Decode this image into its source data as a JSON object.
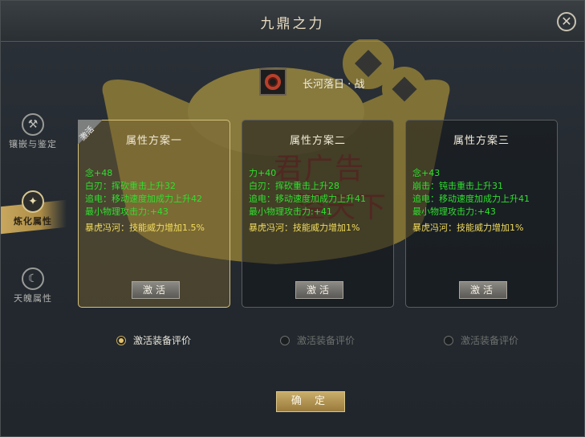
{
  "window": {
    "title": "九鼎之力"
  },
  "item": {
    "name": "长河落日 · 战"
  },
  "sidebar": {
    "items": [
      {
        "label": "镶嵌与鉴定",
        "active": false
      },
      {
        "label": "炼化属性",
        "active": true
      },
      {
        "label": "天魄属性",
        "active": false
      }
    ]
  },
  "plans": [
    {
      "title": "属性方案一",
      "badge": "激活",
      "attrs_green": [
        "念+48",
        "白刃：挥砍重击上升32",
        "追电：移动速度加成力上升42",
        "最小物理攻击力:+43"
      ],
      "attr_yellow": "暴虎冯河：技能威力增加1.5%",
      "button": "激活"
    },
    {
      "title": "属性方案二",
      "attrs_green": [
        "力+40",
        "白刃：挥砍重击上升28",
        "追电：移动速度加成力上升41",
        "最小物理攻击力:+41"
      ],
      "attr_yellow": "暴虎冯河：技能威力增加1%",
      "button": "激活"
    },
    {
      "title": "属性方案三",
      "attrs_green": [
        "念+43",
        "崩击：钝击重击上升31",
        "追电：移动速度加成力上升41",
        "最小物理攻击力:+43"
      ],
      "attr_yellow": "暴虎冯河：技能威力增加1%",
      "button": "激活"
    }
  ],
  "radios": [
    {
      "label": "激活装备评价",
      "checked": true
    },
    {
      "label": "激活装备评价",
      "checked": false
    },
    {
      "label": "激活装备评价",
      "checked": false
    }
  ],
  "confirm_label": "确 定",
  "watermark": {
    "line1": "君广告",
    "line2": "泾天下"
  },
  "colors": {
    "attr_green": "#2ee02e",
    "attr_yellow": "#f2dc5e",
    "accent_gold": "#c9ad6a"
  }
}
